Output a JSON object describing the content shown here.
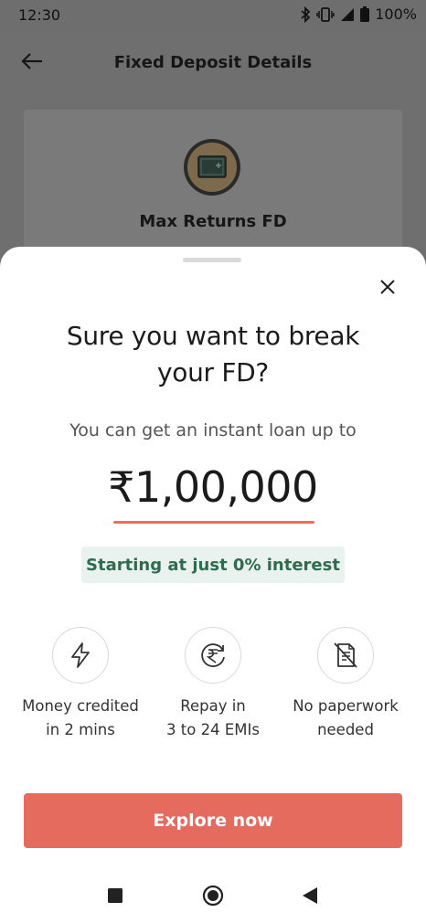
{
  "status_bar": {
    "time": "12:30",
    "battery": "100%"
  },
  "app_bar": {
    "title": "Fixed Deposit Details"
  },
  "background_card": {
    "fd_name": "Max Returns FD"
  },
  "sheet": {
    "title_line1": "Sure you want to break",
    "title_line2": "your FD?",
    "subtitle": "You can get an instant loan up to",
    "amount": "₹1,00,000",
    "interest_badge": "Starting at just 0% interest",
    "features": [
      {
        "icon": "lightning-icon",
        "line1": "Money credited",
        "line2": "in 2 mins"
      },
      {
        "icon": "rupee-repay-icon",
        "line1": "Repay in",
        "line2": "3 to 24 EMIs"
      },
      {
        "icon": "no-paperwork-icon",
        "line1": "No paperwork",
        "line2": "needed"
      }
    ],
    "cta_label": "Explore now"
  },
  "colors": {
    "accent": "#e56b5f",
    "badge_bg": "#e9f2ee",
    "badge_text": "#2f6b4f"
  }
}
